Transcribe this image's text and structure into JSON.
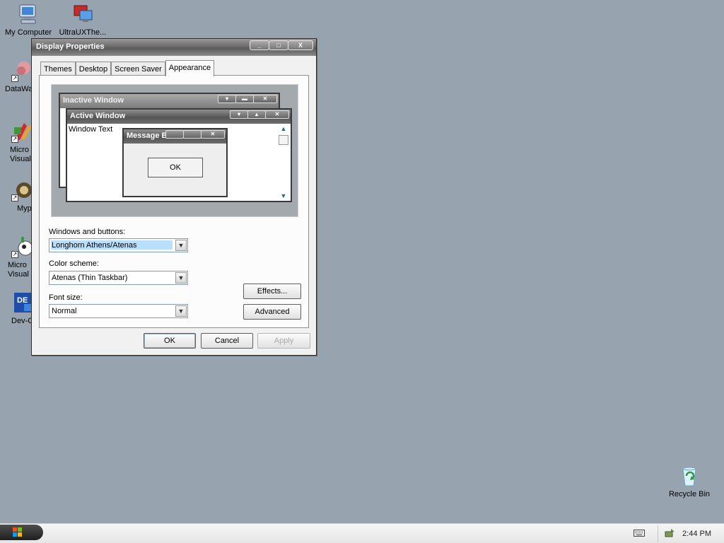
{
  "desktop": {
    "icons": [
      {
        "label": "My Computer"
      },
      {
        "label": "UltraUXThe..."
      },
      {
        "label": "DataWa"
      },
      {
        "label": "Micro\nVisual"
      },
      {
        "label": "Myp"
      },
      {
        "label": "Micro\nVisual"
      },
      {
        "label": "Dev-C"
      },
      {
        "label": "Recycle Bin"
      }
    ]
  },
  "dialog": {
    "title": "Display Properties",
    "title_buttons": [
      "_",
      "□",
      "X"
    ],
    "tabs": [
      {
        "label": "Themes",
        "active": false
      },
      {
        "label": "Desktop",
        "active": false
      },
      {
        "label": "Screen Saver",
        "active": false
      },
      {
        "label": "Appearance",
        "active": true
      }
    ],
    "preview": {
      "inactive_title": "Inactive Window",
      "active_title": "Active Window",
      "window_text": "Window Text",
      "message_box_title": "Message Box",
      "ok_label": "OK"
    },
    "windows_and_buttons": {
      "label": "Windows and buttons:",
      "value": "Longhorn Athens/Atenas"
    },
    "color_scheme": {
      "label": "Color scheme:",
      "value": "Atenas (Thin Taskbar)"
    },
    "font_size": {
      "label": "Font size:",
      "value": "Normal"
    },
    "effects_label": "Effects...",
    "advanced_label": "Advanced",
    "ok_label": "OK",
    "cancel_label": "Cancel",
    "apply_label": "Apply"
  },
  "taskbar": {
    "clock": "2:44 PM"
  }
}
